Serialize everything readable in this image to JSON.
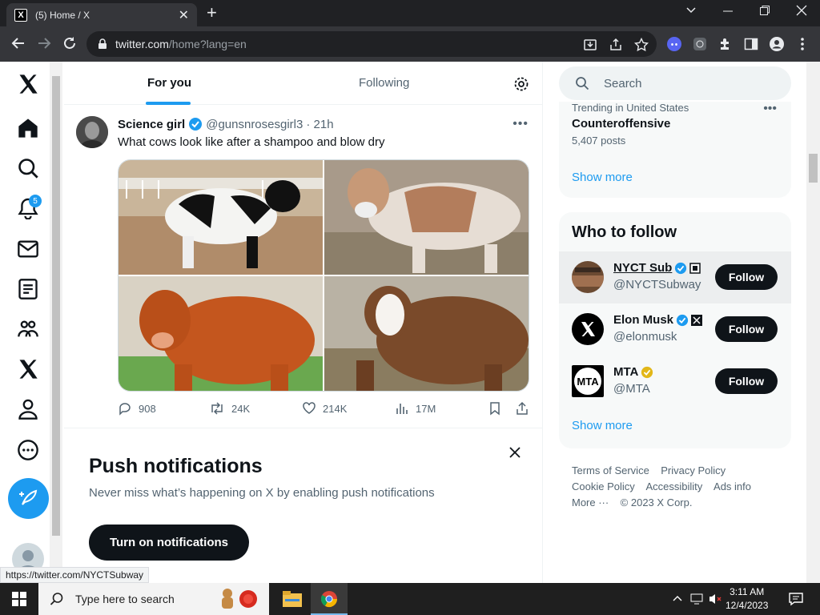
{
  "browser": {
    "tab_title": "(5) Home / X",
    "tab_favicon": "X",
    "url_host": "twitter.com",
    "url_path": "/home?lang=en",
    "status_url": "https://twitter.com/NYCTSubway"
  },
  "nav": {
    "notification_count": "5"
  },
  "timeline": {
    "tabs": [
      "For you",
      "Following"
    ],
    "active_tab": "For you"
  },
  "tweet": {
    "name": "Science girl",
    "handle": "@gunsnrosesgirl3",
    "time": "· 21h",
    "text": "What cows look like after a shampoo and blow dry",
    "replies": "908",
    "reposts": "24K",
    "likes": "214K",
    "views": "17M"
  },
  "push": {
    "title": "Push notifications",
    "subtitle": "Never miss what’s happening on X by enabling push notifications",
    "button": "Turn on notifications"
  },
  "sidebar": {
    "search_placeholder": "Search",
    "trend": {
      "context": "Trending in United States",
      "name": "Counteroffensive",
      "posts": "5,407 posts",
      "show_more": "Show more"
    },
    "who_to_follow": {
      "title": "Who to follow",
      "accounts": [
        {
          "name": "NYCT Sub",
          "handle": "@NYCTSubway",
          "button": "Follow"
        },
        {
          "name": "Elon Musk",
          "handle": "@elonmusk",
          "button": "Follow"
        },
        {
          "name": "MTA",
          "handle": "@MTA",
          "button": "Follow"
        }
      ],
      "show_more": "Show more"
    },
    "footer": {
      "terms": "Terms of Service",
      "privacy": "Privacy Policy",
      "cookie": "Cookie Policy",
      "accessibility": "Accessibility",
      "ads": "Ads info",
      "more": "More ···",
      "copyright": "© 2023 X Corp."
    }
  },
  "taskbar": {
    "search_placeholder": "Type here to search",
    "time": "3:11 AM",
    "date": "12/4/2023"
  },
  "colors": {
    "accent": "#1d9bf0",
    "text": "#0f1419",
    "muted": "#536471",
    "verified_gold": "#e2b719"
  }
}
